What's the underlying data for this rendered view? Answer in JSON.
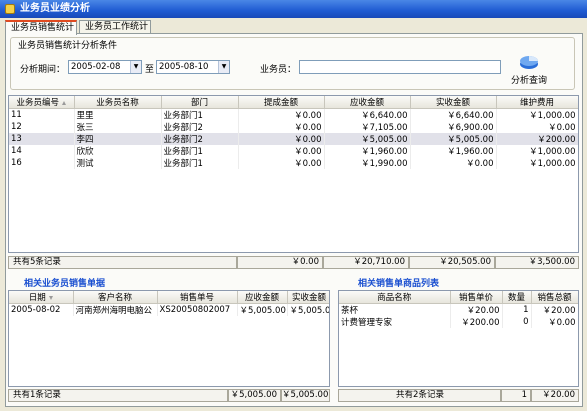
{
  "window": {
    "title": "业务员业绩分析"
  },
  "tabs": [
    {
      "label": "业务员销售统计",
      "active": true
    },
    {
      "label": "业务员工作统计",
      "active": false
    }
  ],
  "conditions": {
    "legend": "业务员销售统计分析条件",
    "period_label": "分析期间：",
    "date_from": "2005-02-08",
    "to_label": "至",
    "date_to": "2005-08-10",
    "salesman_label": "业务员：",
    "salesman_value": "",
    "query_button": "分析查询",
    "query_icon": "pie-chart-icon"
  },
  "main_table": {
    "columns": [
      "业务员编号",
      "业务员名称",
      "部门",
      "提成金额",
      "应收金额",
      "实收金额",
      "维护费用"
    ],
    "rows": [
      [
        "11",
        "里里",
        "业务部门1",
        "￥0.00",
        "￥6,640.00",
        "￥6,640.00",
        "￥1,000.00"
      ],
      [
        "12",
        "张三",
        "业务部门2",
        "￥0.00",
        "￥7,105.00",
        "￥6,900.00",
        "￥0.00"
      ],
      [
        "13",
        "李四",
        "业务部门2",
        "￥0.00",
        "￥5,005.00",
        "￥5,005.00",
        "￥200.00"
      ],
      [
        "14",
        "欣欣",
        "业务部门1",
        "￥0.00",
        "￥1,960.00",
        "￥1,960.00",
        "￥1,000.00"
      ],
      [
        "16",
        "测试",
        "业务部门1",
        "￥0.00",
        "￥1,990.00",
        "￥0.00",
        "￥1,000.00"
      ]
    ],
    "selected_row": 2,
    "footer": {
      "count": "共有5条记录",
      "commission": "￥0.00",
      "receivable": "￥20,710.00",
      "received": "￥20,505.00",
      "maintenance": "￥3,500.00"
    }
  },
  "orders": {
    "title": "相关业务员销售单据",
    "columns": [
      "日期",
      "客户名称",
      "销售单号",
      "应收金额",
      "实收金额"
    ],
    "rows": [
      [
        "2005-08-02",
        "河南郑州海明电脑公",
        "XS20050802007",
        "￥5,005.00",
        "￥5,005.00"
      ]
    ],
    "footer": {
      "count": "共有1条记录",
      "receivable": "￥5,005.00",
      "received": "￥5,005.00"
    }
  },
  "products": {
    "title": "相关销售单商品列表",
    "columns": [
      "商品名称",
      "销售单价",
      "数量",
      "销售总额"
    ],
    "rows": [
      [
        "茶杯",
        "￥20.00",
        "1",
        "￥20.00"
      ],
      [
        "计费管理专家",
        "￥200.00",
        "0",
        "￥0.00"
      ]
    ],
    "footer": {
      "count": "共有2条记录",
      "qty": "1",
      "total": "￥20.00"
    }
  }
}
